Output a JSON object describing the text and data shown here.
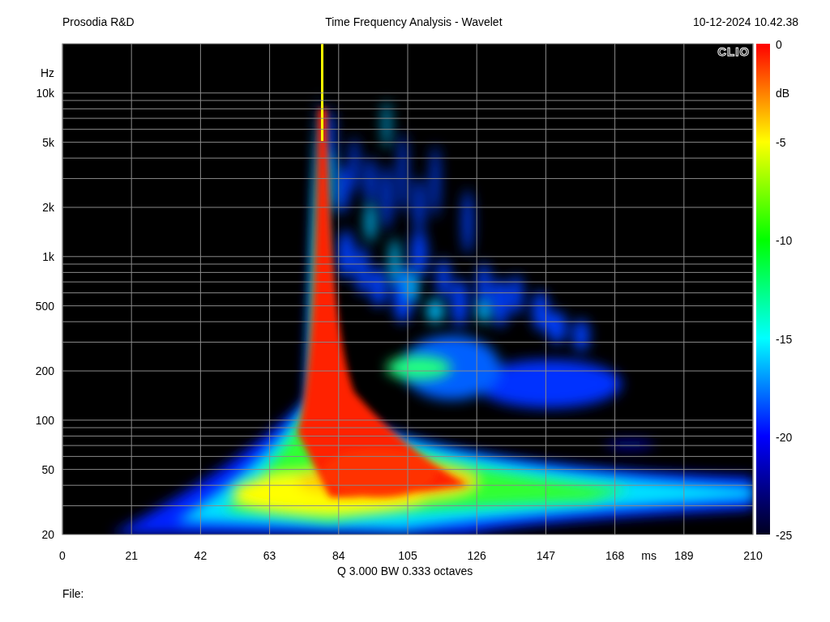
{
  "header": {
    "company": "Prosodia R&D",
    "title": "Time Frequency Analysis - Wavelet",
    "timestamp": "10-12-2024 10.42.38"
  },
  "plot": {
    "logo": "CLIO",
    "y_unit": "Hz",
    "y_ticks": [
      "10k",
      "5k",
      "2k",
      "1k",
      "500",
      "200",
      "100",
      "50",
      "20"
    ],
    "x_ticks": [
      "0",
      "21",
      "42",
      "63",
      "84",
      "105",
      "126",
      "147",
      "168",
      "189",
      "210"
    ],
    "x_unit": "ms",
    "colorbar": {
      "unit": "dB",
      "ticks": [
        "0",
        "-5",
        "-10",
        "-15",
        "-20",
        "-25"
      ]
    }
  },
  "caption": "Q 3.000 BW 0.333 octaves",
  "file_label": "File:"
}
